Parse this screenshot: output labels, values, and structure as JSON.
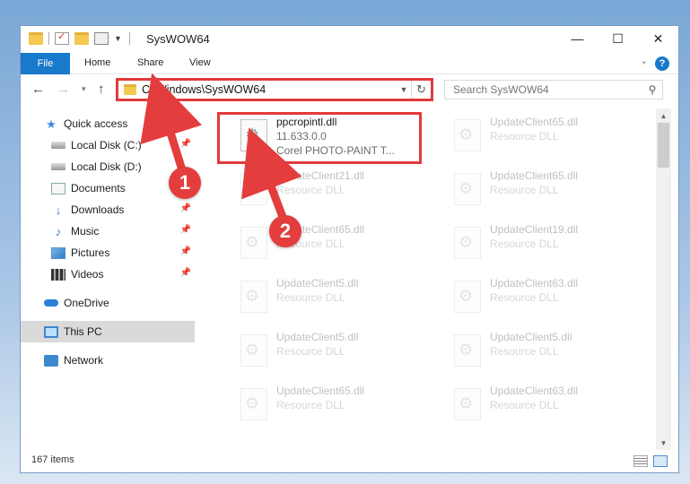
{
  "window": {
    "title": "SysWOW64",
    "controls": {
      "minimize": "—",
      "maximize": "☐",
      "close": "✕"
    }
  },
  "ribbon": {
    "file": "File",
    "tabs": [
      "Home",
      "Share",
      "View"
    ],
    "help": "?"
  },
  "address": {
    "path": "C:\\Windows\\SysWOW64",
    "search_placeholder": "Search SysWOW64"
  },
  "sidebar": {
    "items": [
      {
        "label": "Quick access",
        "pinned": false
      },
      {
        "label": "Local Disk (C:)",
        "pinned": true
      },
      {
        "label": "Local Disk (D:)",
        "pinned": false
      },
      {
        "label": "Documents",
        "pinned": true
      },
      {
        "label": "Downloads",
        "pinned": true
      },
      {
        "label": "Music",
        "pinned": true
      },
      {
        "label": "Pictures",
        "pinned": true
      },
      {
        "label": "Videos",
        "pinned": true
      },
      {
        "label": "OneDrive",
        "pinned": false
      },
      {
        "label": "This PC",
        "pinned": false
      },
      {
        "label": "Network",
        "pinned": false
      }
    ]
  },
  "files": [
    {
      "name": "ppcropintl.dll",
      "line2": "11.633.0.0",
      "line3": "Corel PHOTO-PAINT T..."
    },
    {
      "name": "UpdateClient65.dll",
      "line2": "Resource DLL"
    },
    {
      "name": "UpdateClient21.dll",
      "line2": "Resource DLL"
    },
    {
      "name": "UpdateClient65.dll",
      "line2": "Resource DLL"
    },
    {
      "name": "UpdateClient65.dll",
      "line2": "Resource DLL"
    },
    {
      "name": "UpdateClient19.dll",
      "line2": "Resource DLL"
    },
    {
      "name": "UpdateClient5.dll",
      "line2": "Resource DLL"
    },
    {
      "name": "UpdateClient63.dll",
      "line2": "Resource DLL"
    },
    {
      "name": "UpdateClient5.dll",
      "line2": "Resource DLL"
    },
    {
      "name": "UpdateClient5.dll",
      "line2": "Resource DLL"
    },
    {
      "name": "UpdateClient65.dll",
      "line2": "Resource DLL"
    },
    {
      "name": "UpdateClient63.dll",
      "line2": "Resource DLL"
    }
  ],
  "status": {
    "count": "167 items"
  },
  "callouts": [
    "1",
    "2"
  ],
  "colors": {
    "highlight": "#e23a3a",
    "accent": "#1979ca"
  }
}
